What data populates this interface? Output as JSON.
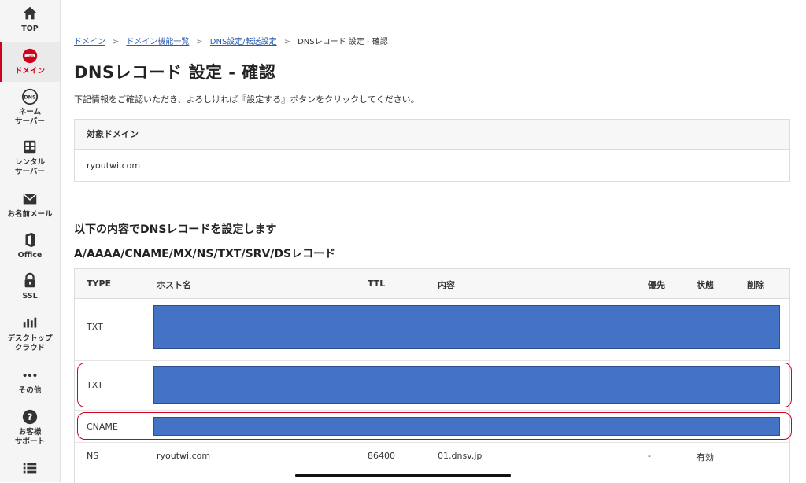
{
  "sidebar": {
    "items": [
      {
        "label": "TOP",
        "icon": "home-icon"
      },
      {
        "label": "ドメイン",
        "icon": "dot-com-icon",
        "active": true
      },
      {
        "label": "ネーム\nサーバー",
        "icon": "dns-icon"
      },
      {
        "label": "レンタル\nサーバー",
        "icon": "server-icon"
      },
      {
        "label": "お名前メール",
        "icon": "mail-icon"
      },
      {
        "label": "Office",
        "icon": "office-icon"
      },
      {
        "label": "SSL",
        "icon": "lock-icon"
      },
      {
        "label": "デスクトップ\nクラウド",
        "icon": "cloud-desktop-icon"
      },
      {
        "label": "その他",
        "icon": "more-icon"
      },
      {
        "label": "お客様\nサポート",
        "icon": "help-icon"
      },
      {
        "label": "",
        "icon": "list-icon"
      }
    ]
  },
  "breadcrumb": {
    "items": [
      "ドメイン",
      "ドメイン機能一覧",
      "DNS設定/転送設定"
    ],
    "current": "DNSレコード 設定 - 確認",
    "separator": ">"
  },
  "page": {
    "title": "DNSレコード 設定 - 確認",
    "description": "下記情報をご確認いただき、よろしければ『設定する』ボタンをクリックしてください。"
  },
  "domain_box": {
    "header": "対象ドメイン",
    "value": "ryoutwi.com"
  },
  "records": {
    "section_title": "以下の内容でDNSレコードを設定します",
    "section_subtitle": "A/AAAA/CNAME/MX/NS/TXT/SRV/DSレコード",
    "columns": [
      "TYPE",
      "ホスト名",
      "TTL",
      "内容",
      "優先",
      "状態",
      "削除"
    ],
    "rows": [
      {
        "type": "TXT",
        "redacted": true
      },
      {
        "type": "TXT",
        "redacted": true,
        "highlighted": true
      },
      {
        "type": "CNAME",
        "redacted": true,
        "highlighted": true
      },
      {
        "type": "NS",
        "host": "ryoutwi.com",
        "ttl": "86400",
        "content": "01.dnsv.jp",
        "priority": "-",
        "status": "有効"
      }
    ]
  },
  "colors": {
    "accent": "#d0021b",
    "link": "#2a5db0",
    "redaction": "#4472c4"
  }
}
